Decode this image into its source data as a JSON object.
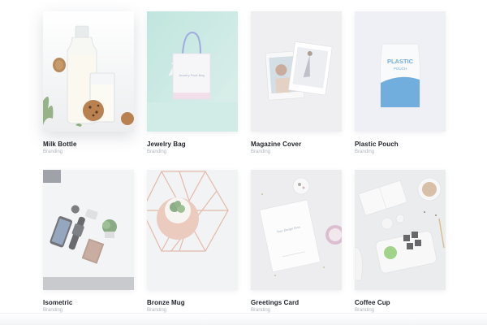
{
  "gallery": {
    "items": [
      {
        "title": "Milk Bottle",
        "category": "Branding",
        "icon": "milk-bottle-image"
      },
      {
        "title": "Jewelry Bag",
        "category": "Branding",
        "icon": "jewelry-bag-image"
      },
      {
        "title": "Magazine Cover",
        "category": "Branding",
        "icon": "magazine-cover-image"
      },
      {
        "title": "Plastic Pouch",
        "category": "Branding",
        "icon": "plastic-pouch-image"
      },
      {
        "title": "Isometric",
        "category": "Branding",
        "icon": "isometric-image"
      },
      {
        "title": "Bronze Mug",
        "category": "Branding",
        "icon": "bronze-mug-image"
      },
      {
        "title": "Greetings Card",
        "category": "Branding",
        "icon": "greetings-card-image"
      },
      {
        "title": "Coffee Cup",
        "category": "Branding",
        "icon": "coffee-cup-image"
      }
    ],
    "bag_text": "Jewelry Pack Bag",
    "pouch_text": [
      "PLASTIC",
      "POUCH"
    ],
    "card_text": "Your Design Here",
    "colors": {
      "pouch_blue": "#3b8fd0",
      "bag_mint": "#9fd5cb",
      "bronze": "#d9a089"
    }
  }
}
